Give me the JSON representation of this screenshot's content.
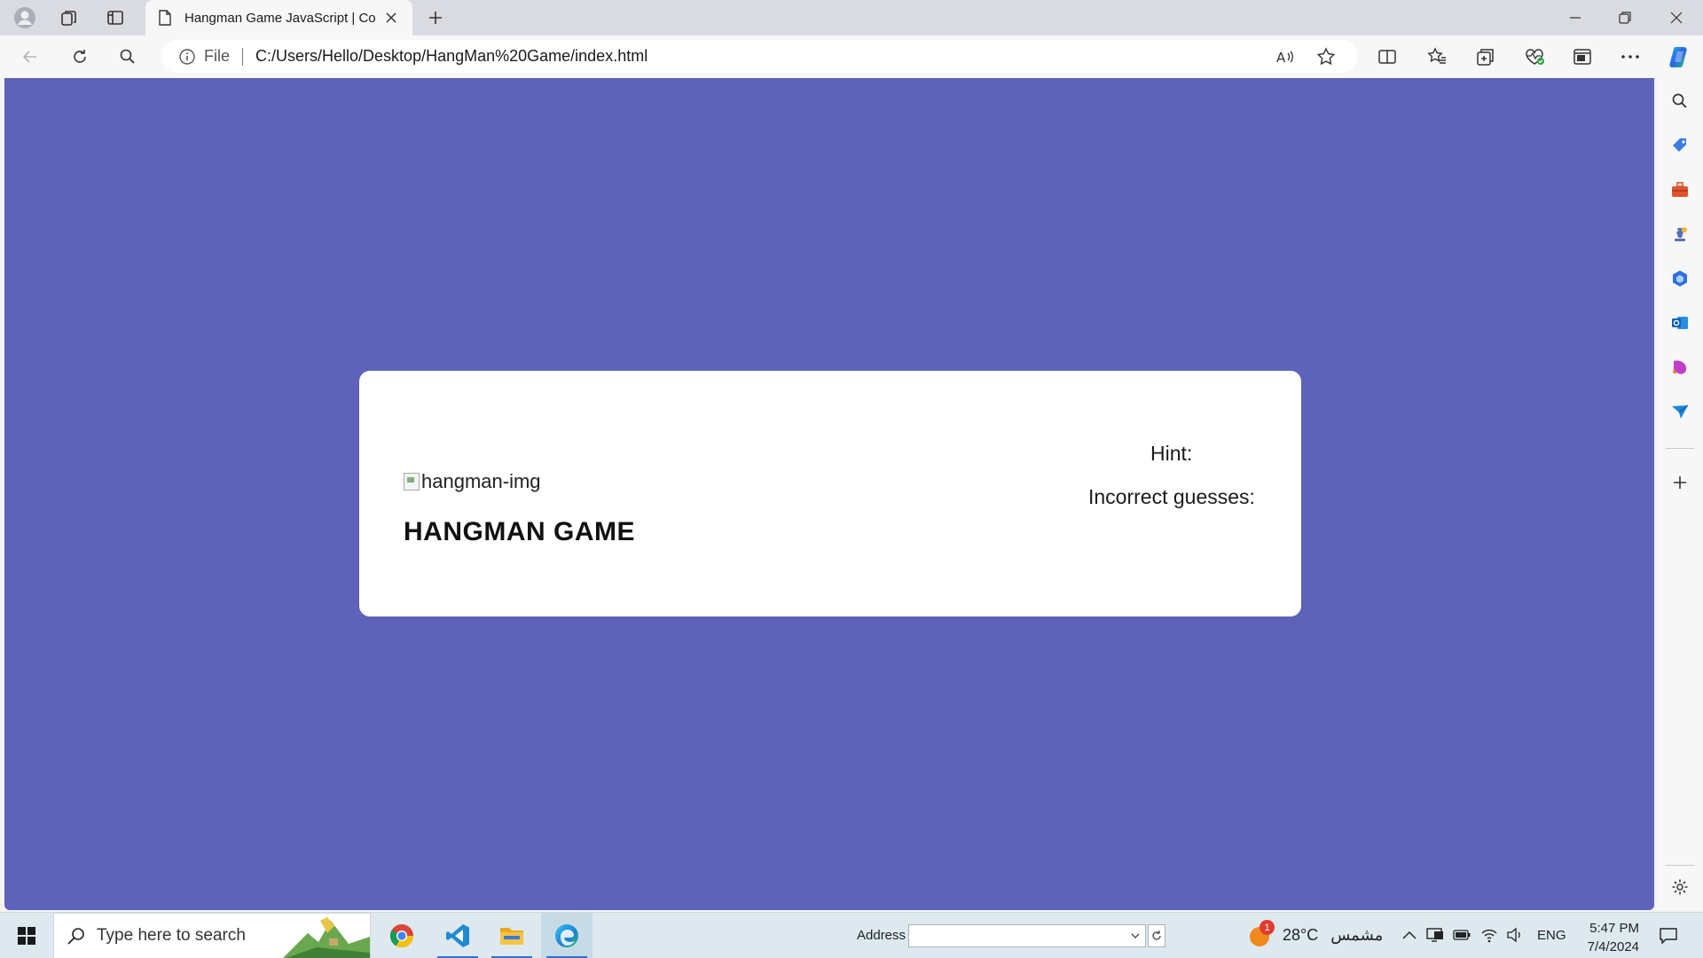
{
  "browser": {
    "tab": {
      "title": "Hangman Game JavaScript | Cod"
    },
    "address": {
      "scheme_label": "File",
      "url": "C:/Users/Hello/Desktop/HangMan%20Game/index.html"
    }
  },
  "page": {
    "image_alt": "hangman-img",
    "title": "HANGMAN GAME",
    "hint_label": "Hint:",
    "incorrect_label": "Incorrect guesses:",
    "background_color": "#5e63b9",
    "card_color": "#ffffff"
  },
  "taskbar": {
    "search_placeholder": "Type here to search",
    "address_label": "Address",
    "weather": {
      "temp": "28°C",
      "condition": "مشمس",
      "badge": "1"
    },
    "language": "ENG",
    "time": "5:47 PM",
    "date": "7/4/2024"
  }
}
